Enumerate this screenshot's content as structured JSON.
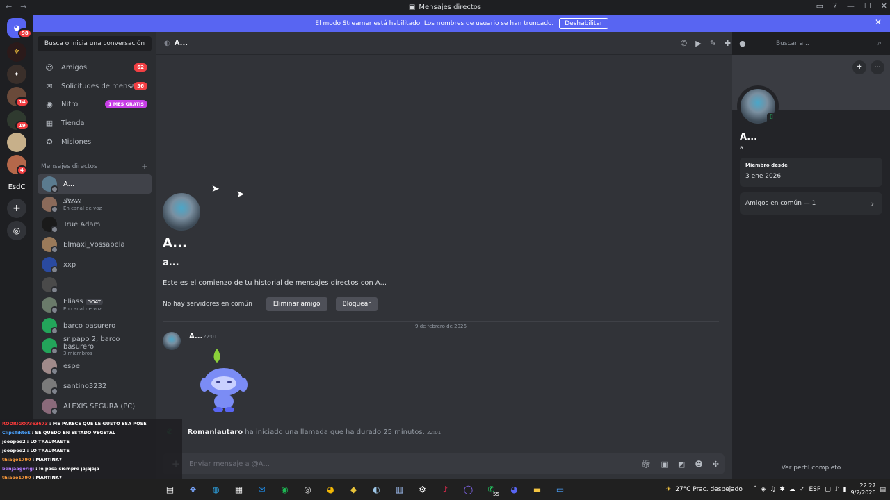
{
  "window": {
    "title": "Mensajes directos"
  },
  "banner": {
    "text": "El modo Streamer está habilitado. Los nombres de usuario se han truncado.",
    "button": "Deshabilitar"
  },
  "guilds": {
    "home_badge": "98",
    "badges": [
      "14",
      "19",
      "4"
    ],
    "text_server": "EsdC"
  },
  "sidebar": {
    "search_button": "Busca o inicia una conversación",
    "nav": [
      {
        "label": "Amigos",
        "badge": "62",
        "icon": "people-icon"
      },
      {
        "label": "Solicitudes de mensa...",
        "badge": "36",
        "icon": "envelope-icon"
      },
      {
        "label": "Nitro",
        "badge": "1 MES GRATIS",
        "icon": "nitro-icon"
      },
      {
        "label": "Tienda",
        "badge": "",
        "icon": "shop-icon"
      },
      {
        "label": "Misiones",
        "badge": "",
        "icon": "quest-icon"
      }
    ],
    "dm_header": "Mensajes directos",
    "dms": [
      {
        "name": "A...",
        "sub": ""
      },
      {
        "name": "𝓟𝓲𝓵𝓲𝓲𝓲",
        "sub": "En canal de voz"
      },
      {
        "name": "True Adam",
        "sub": ""
      },
      {
        "name": "Elmaxi_vossabela",
        "sub": ""
      },
      {
        "name": "xxp",
        "sub": ""
      },
      {
        "name": "",
        "sub": ""
      },
      {
        "name": "Eliass",
        "sub": "En canal de voz",
        "tag": "GOAT"
      },
      {
        "name": "barco basurero",
        "sub": ""
      },
      {
        "name": "sr papo 2, barco basurero",
        "sub": "3 miembros"
      },
      {
        "name": "espe",
        "sub": ""
      },
      {
        "name": "santino3232",
        "sub": ""
      },
      {
        "name": "ALEXIS SEGURA (PC)",
        "sub": ""
      }
    ]
  },
  "chat": {
    "header_name": "A...",
    "search_placeholder": "Buscar a...",
    "intro_name": "A...",
    "intro_user": "a...",
    "intro_desc": "Este es el comienzo de tu historial de mensajes directos con A...",
    "no_servers": "No hay servidores en común",
    "remove_friend": "Eliminar amigo",
    "block": "Bloquear",
    "date_separator": "9 de febrero de 2026",
    "message": {
      "author": "A...",
      "time": "22:01"
    },
    "call": {
      "caller": "Romanlautaro",
      "text": "ha iniciado una llamada que ha durado 25 minutos.",
      "time": "22:01"
    },
    "composer_placeholder": "Enviar mensaje a @A..."
  },
  "profile": {
    "name": "A...",
    "username": "a...",
    "member_since_label": "Miembro desde",
    "member_since": "3 ene 2026",
    "mutual_friends": "Amigos en común — 1",
    "view_full": "Ver perfil completo"
  },
  "overlay": [
    {
      "user": "RODRIGO7363673",
      "msg": ": ME PARECE QUE LE GUSTO ESA POSE",
      "color": "#ff3b3b"
    },
    {
      "user": "ClipsTiktok",
      "msg": ": SE QUEDO EN ESTADO VEGETAL",
      "color": "#4ba3ff"
    },
    {
      "user": "jooopee2",
      "msg": ": LO TRAUMASTE",
      "color": "#ffffff"
    },
    {
      "user": "jooopee2",
      "msg": ": LO TRAUMASTE",
      "color": "#ffffff"
    },
    {
      "user": "thiago1790",
      "msg": ": MARTINA?",
      "color": "#ff9c3b"
    },
    {
      "user": "benjaagorigi",
      "msg": ": le pasa siempre jajajaja",
      "color": "#b47cff"
    },
    {
      "user": "thiago1790",
      "msg": ": MARTINA?",
      "color": "#ff9c3b"
    }
  ],
  "taskbar": {
    "weather": "27°C  Prac. despejado",
    "lang": "ESP",
    "time": "22:27",
    "date": "9/2/2026",
    "whatsapp_badge": "55"
  }
}
